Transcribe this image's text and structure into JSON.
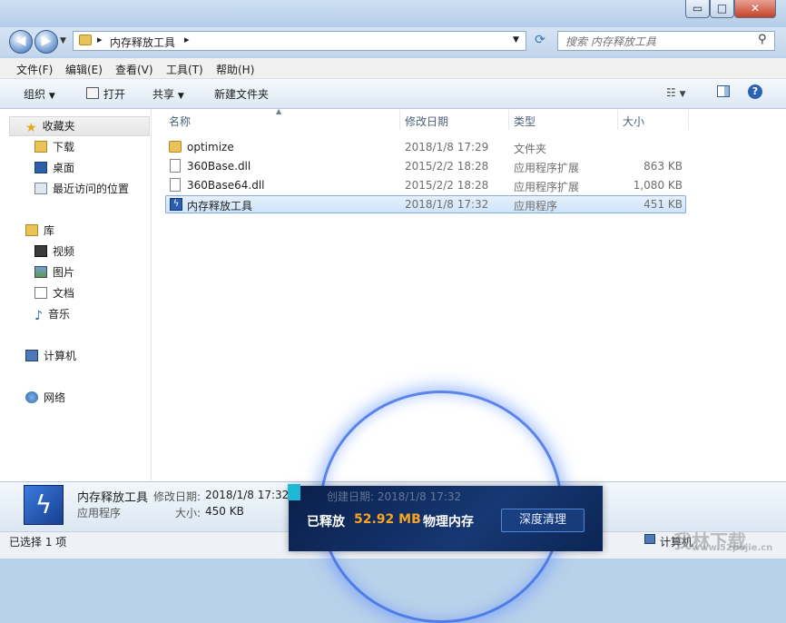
{
  "window": {
    "min_label": "▭",
    "max_label": "□",
    "close_label": "✕"
  },
  "nav": {
    "back_label": "◀",
    "forward_label": "▶"
  },
  "address": {
    "folder_name": "内存释放工具",
    "sep1": "▸",
    "sep2": "▸"
  },
  "search": {
    "placeholder": "搜索 内存释放工具"
  },
  "menubar": [
    {
      "label": "文件(F)"
    },
    {
      "label": "编辑(E)"
    },
    {
      "label": "查看(V)"
    },
    {
      "label": "工具(T)"
    },
    {
      "label": "帮助(H)"
    }
  ],
  "toolbar": {
    "organize": "组织",
    "open": "打开",
    "share": "共享",
    "new_folder": "新建文件夹"
  },
  "sidebar": {
    "favorites": "收藏夹",
    "fav_items": [
      {
        "label": "下载"
      },
      {
        "label": "桌面"
      },
      {
        "label": "最近访问的位置"
      }
    ],
    "libraries": "库",
    "lib_items": [
      {
        "label": "视频"
      },
      {
        "label": "图片"
      },
      {
        "label": "文档"
      },
      {
        "label": "音乐"
      }
    ],
    "computer": "计算机",
    "network": "网络"
  },
  "columns": {
    "name": "名称",
    "date": "修改日期",
    "type": "类型",
    "size": "大小"
  },
  "files": [
    {
      "name": "optimize",
      "date": "2018/1/8 17:29",
      "type": "文件夹",
      "size": ""
    },
    {
      "name": "360Base.dll",
      "date": "2015/2/2 18:28",
      "type": "应用程序扩展",
      "size": "863 KB"
    },
    {
      "name": "360Base64.dll",
      "date": "2015/2/2 18:28",
      "type": "应用程序扩展",
      "size": "1,080 KB"
    },
    {
      "name": "内存释放工具",
      "date": "2018/1/8 17:32",
      "type": "应用程序",
      "size": "451 KB"
    }
  ],
  "details": {
    "name": "内存释放工具",
    "date_label": "修改日期:",
    "date_value": "2018/1/8 17:32",
    "ghost_date": "创建日期: 2018/1/8 17:32",
    "type": "应用程序",
    "size_label": "大小:",
    "size_value": "450 KB"
  },
  "status": {
    "text": "已选择 1 项",
    "computer": "计算机"
  },
  "popup": {
    "prefix": "已释放",
    "amount": "52.92 MB",
    "suffix": "物理内存",
    "button": "深度清理"
  },
  "watermark": {
    "main": "我林下载",
    "url": "www.52pojie.cn"
  },
  "colors": {
    "accent_orange": "#f5a523",
    "selection": "#cfe4fb"
  }
}
